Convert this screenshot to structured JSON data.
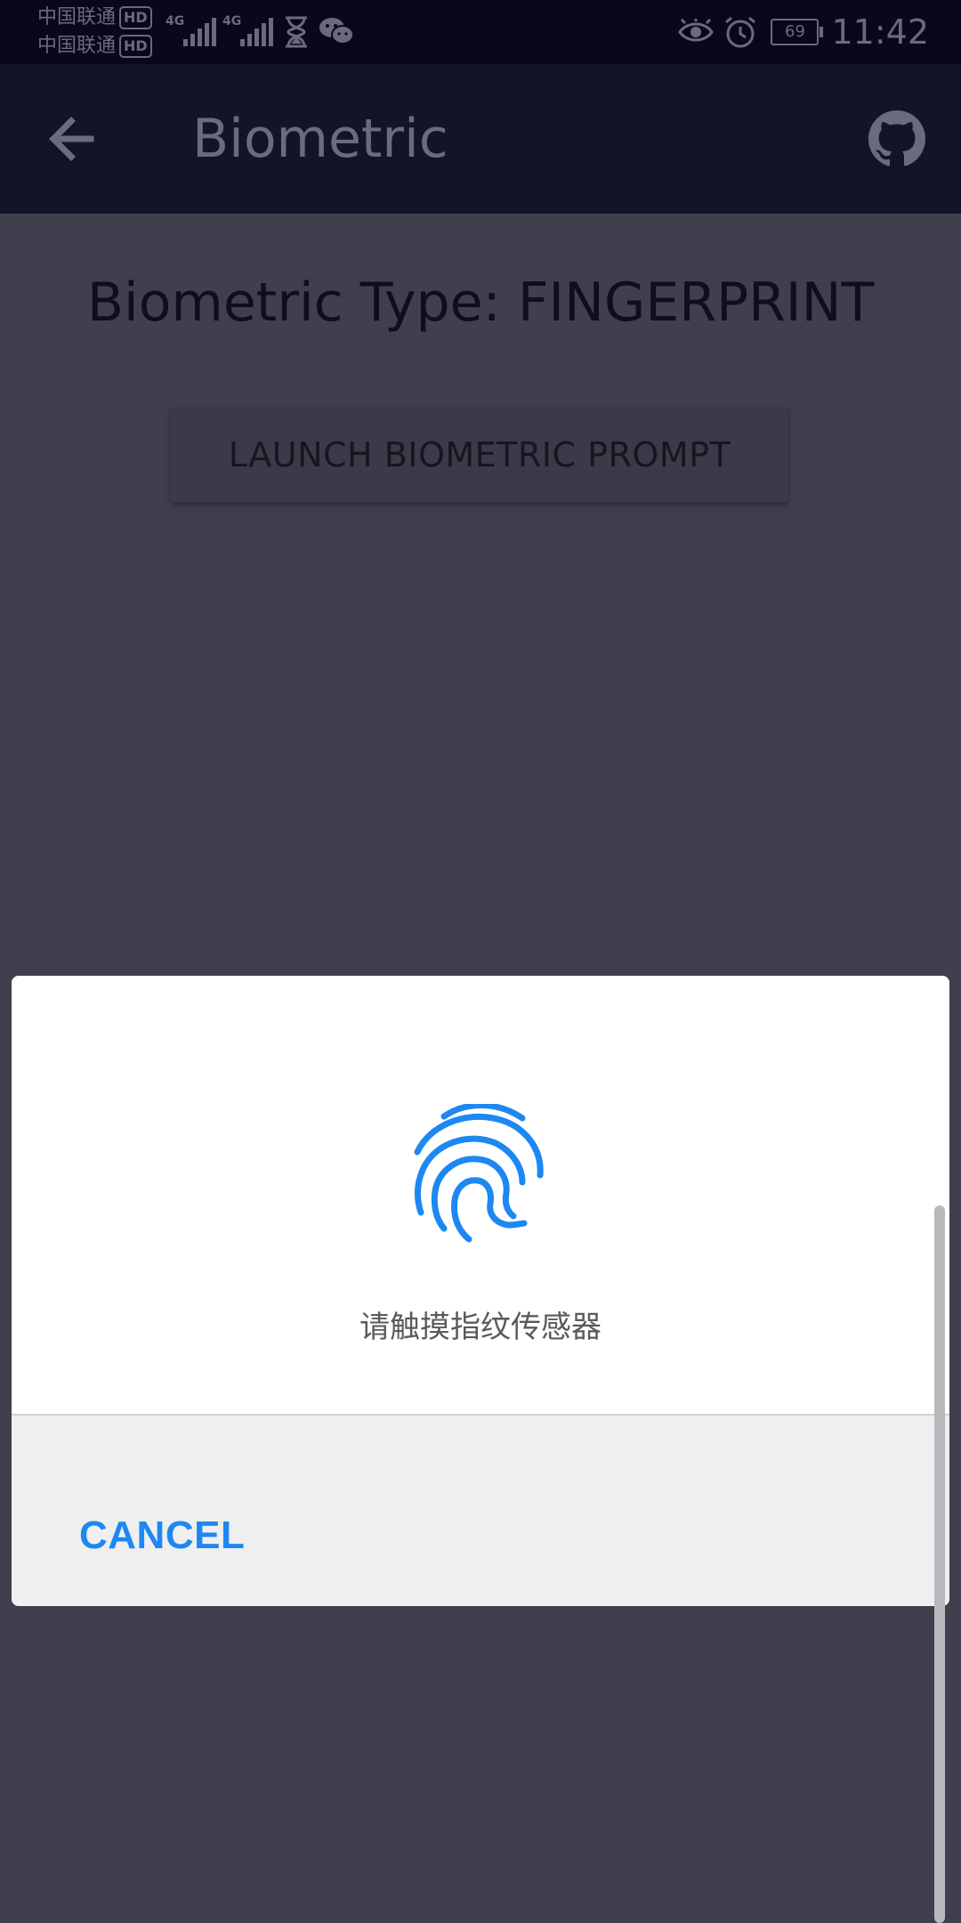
{
  "status_bar": {
    "carrier_1": "中国联通",
    "carrier_2": "中国联通",
    "hd_badge": "HD",
    "network_1": "4G",
    "network_2": "4G",
    "battery": "69",
    "time": "11:42",
    "icons": [
      "eye-icon",
      "alarm-icon",
      "hourglass-icon",
      "wechat-icon"
    ]
  },
  "app_bar": {
    "title": "Biometric",
    "back_icon": "arrow-left-icon",
    "github_icon": "github-icon"
  },
  "main": {
    "biometric_type_label": "Biometric Type: FINGERPRINT",
    "launch_button_label": "LAUNCH BIOMETRIC PROMPT"
  },
  "dialog": {
    "icon": "fingerprint-icon",
    "prompt_text": "请触摸指纹传感器",
    "cancel_label": "CANCEL"
  },
  "colors": {
    "accent": "#1d88f2",
    "app_bar": "#13132a",
    "background_dimmed": "#403f4e"
  }
}
